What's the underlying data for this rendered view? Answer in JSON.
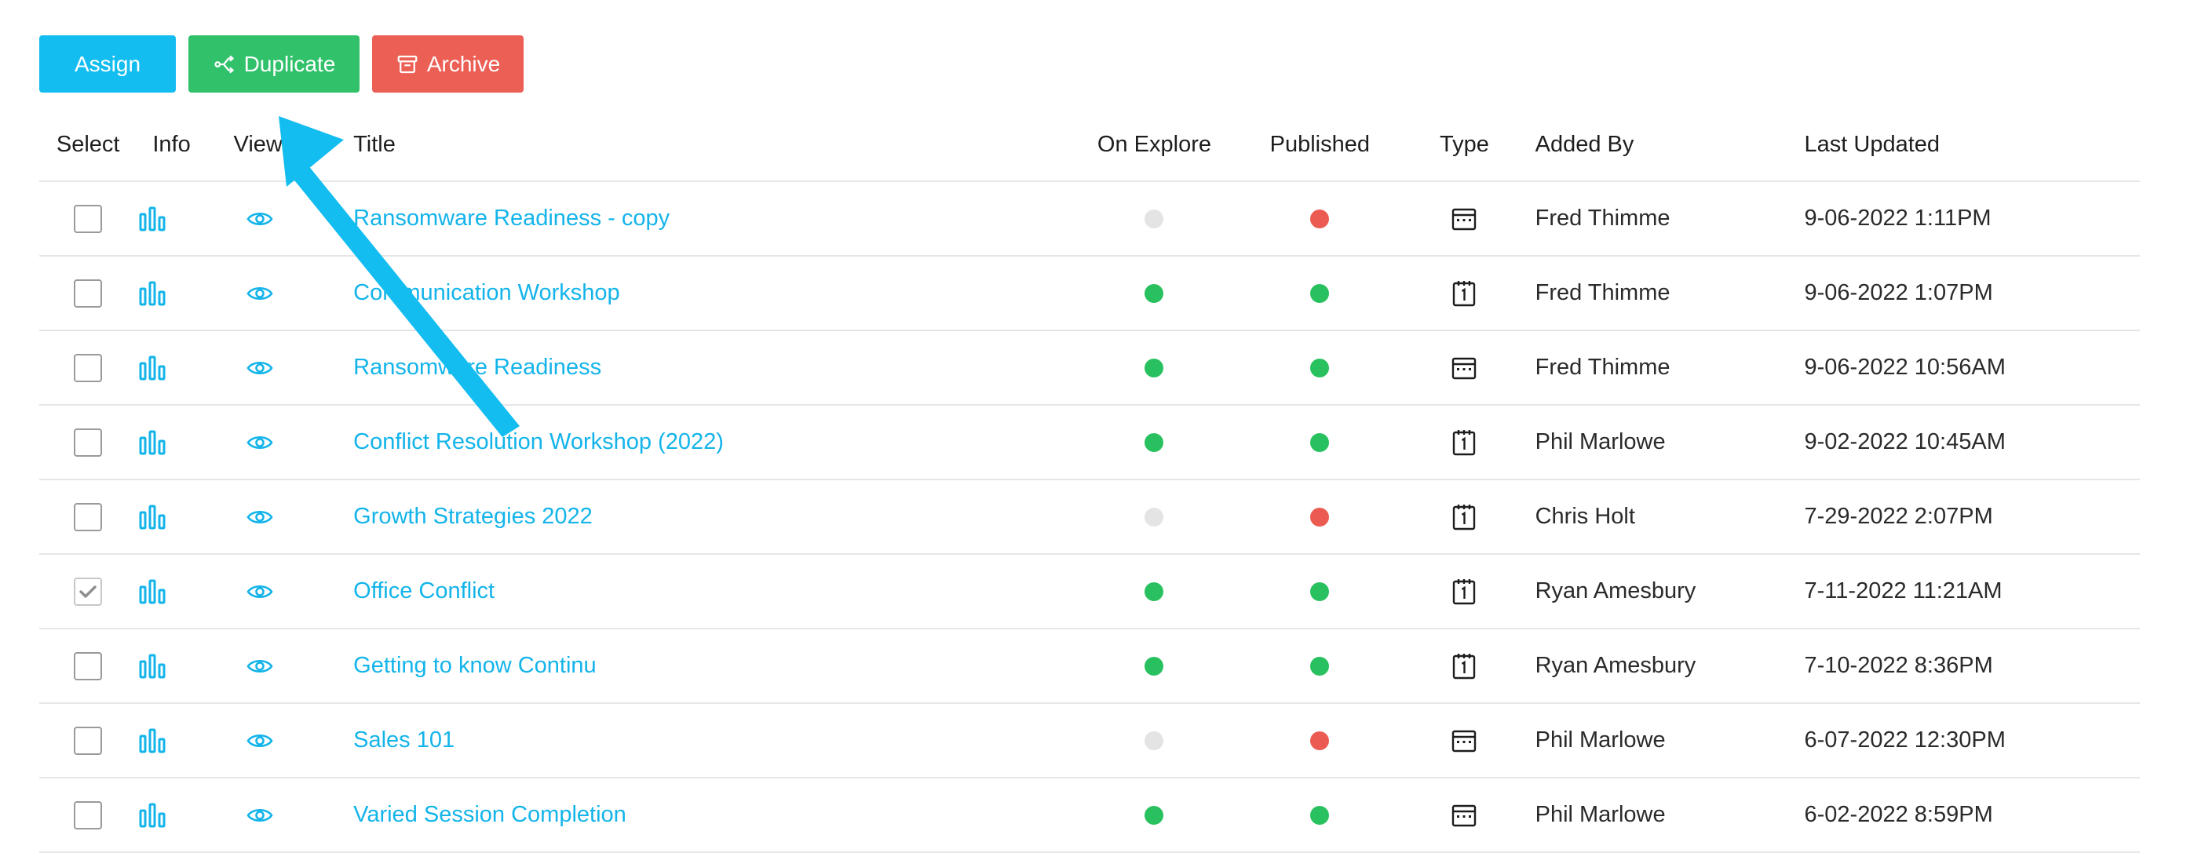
{
  "toolbar": {
    "assign_label": "Assign",
    "duplicate_label": "Duplicate",
    "archive_label": "Archive"
  },
  "colors": {
    "accent": "#13bdf0",
    "success": "#30c16a",
    "danger": "#ec5f55"
  },
  "table": {
    "headers": {
      "select": "Select",
      "info": "Info",
      "view": "View",
      "title": "Title",
      "on_explore": "On Explore",
      "published": "Published",
      "type": "Type",
      "added_by": "Added By",
      "last_updated": "Last Updated"
    },
    "rows": [
      {
        "checked": false,
        "title": "Ransomware Readiness - copy",
        "on_explore": "gray",
        "published": "red",
        "type": "calendar-icon",
        "added_by": "Fred Thimme",
        "last_updated": "9-06-2022 1:11PM"
      },
      {
        "checked": false,
        "title": "Communication Workshop",
        "on_explore": "green",
        "published": "green",
        "type": "day-calendar-icon",
        "added_by": "Fred Thimme",
        "last_updated": "9-06-2022 1:07PM"
      },
      {
        "checked": false,
        "title": "Ransomware Readiness",
        "on_explore": "green",
        "published": "green",
        "type": "calendar-icon",
        "added_by": "Fred Thimme",
        "last_updated": "9-06-2022 10:56AM"
      },
      {
        "checked": false,
        "title": "Conflict Resolution Workshop (2022)",
        "on_explore": "green",
        "published": "green",
        "type": "day-calendar-icon",
        "added_by": "Phil Marlowe",
        "last_updated": "9-02-2022 10:45AM"
      },
      {
        "checked": false,
        "title": "Growth Strategies 2022",
        "on_explore": "gray",
        "published": "red",
        "type": "day-calendar-icon",
        "added_by": "Chris Holt",
        "last_updated": "7-29-2022 2:07PM"
      },
      {
        "checked": true,
        "title": "Office Conflict",
        "on_explore": "green",
        "published": "green",
        "type": "day-calendar-icon",
        "added_by": "Ryan Amesbury",
        "last_updated": "7-11-2022 11:21AM"
      },
      {
        "checked": false,
        "title": "Getting to know Continu",
        "on_explore": "green",
        "published": "green",
        "type": "day-calendar-icon",
        "added_by": "Ryan Amesbury",
        "last_updated": "7-10-2022 8:36PM"
      },
      {
        "checked": false,
        "title": "Sales 101",
        "on_explore": "gray",
        "published": "red",
        "type": "calendar-icon",
        "added_by": "Phil Marlowe",
        "last_updated": "6-07-2022 12:30PM"
      },
      {
        "checked": false,
        "title": "Varied Session Completion",
        "on_explore": "green",
        "published": "green",
        "type": "calendar-icon",
        "added_by": "Phil Marlowe",
        "last_updated": "6-02-2022 8:59PM"
      }
    ]
  }
}
